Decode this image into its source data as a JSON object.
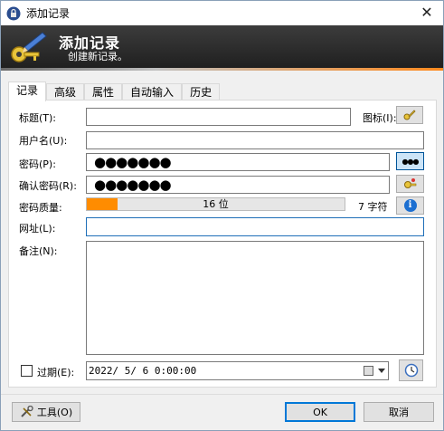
{
  "window": {
    "title": "添加记录",
    "close_glyph": "✕"
  },
  "banner": {
    "title": "添加记录",
    "subtitle": "创建新记录。"
  },
  "tabs": [
    {
      "label": "记录",
      "active": true
    },
    {
      "label": "高级",
      "active": false
    },
    {
      "label": "属性",
      "active": false
    },
    {
      "label": "自动输入",
      "active": false
    },
    {
      "label": "历史",
      "active": false
    }
  ],
  "form": {
    "title_label": "标题(T):",
    "title_value": "",
    "icon_label": "图标(I):",
    "username_label": "用户名(U):",
    "username_value": "",
    "password_label": "密码(P):",
    "password_mask": "●●●●●●●",
    "confirm_label": "确认密码(R):",
    "confirm_mask": "●●●●●●●",
    "quality_label": "密码质量:",
    "quality_text": "16 位",
    "quality_fraction": 0.12,
    "char_count": "7 字符",
    "url_label": "网址(L):",
    "url_value": "",
    "notes_label": "备注(N):",
    "notes_value": "",
    "expire_label": "过期(E):",
    "expire_checked": false,
    "expire_value": "2022/ 5/ 6  0:00:00",
    "show_password_glyph": "●●●",
    "info_glyph": "i"
  },
  "footer": {
    "tools_label": "工具(O)",
    "ok_label": "OK",
    "cancel_label": "取消"
  },
  "colors": {
    "quality_fill": "#ff8c00",
    "focus_border": "#1f6fb8",
    "banner_accent": "#ff8a1e"
  }
}
